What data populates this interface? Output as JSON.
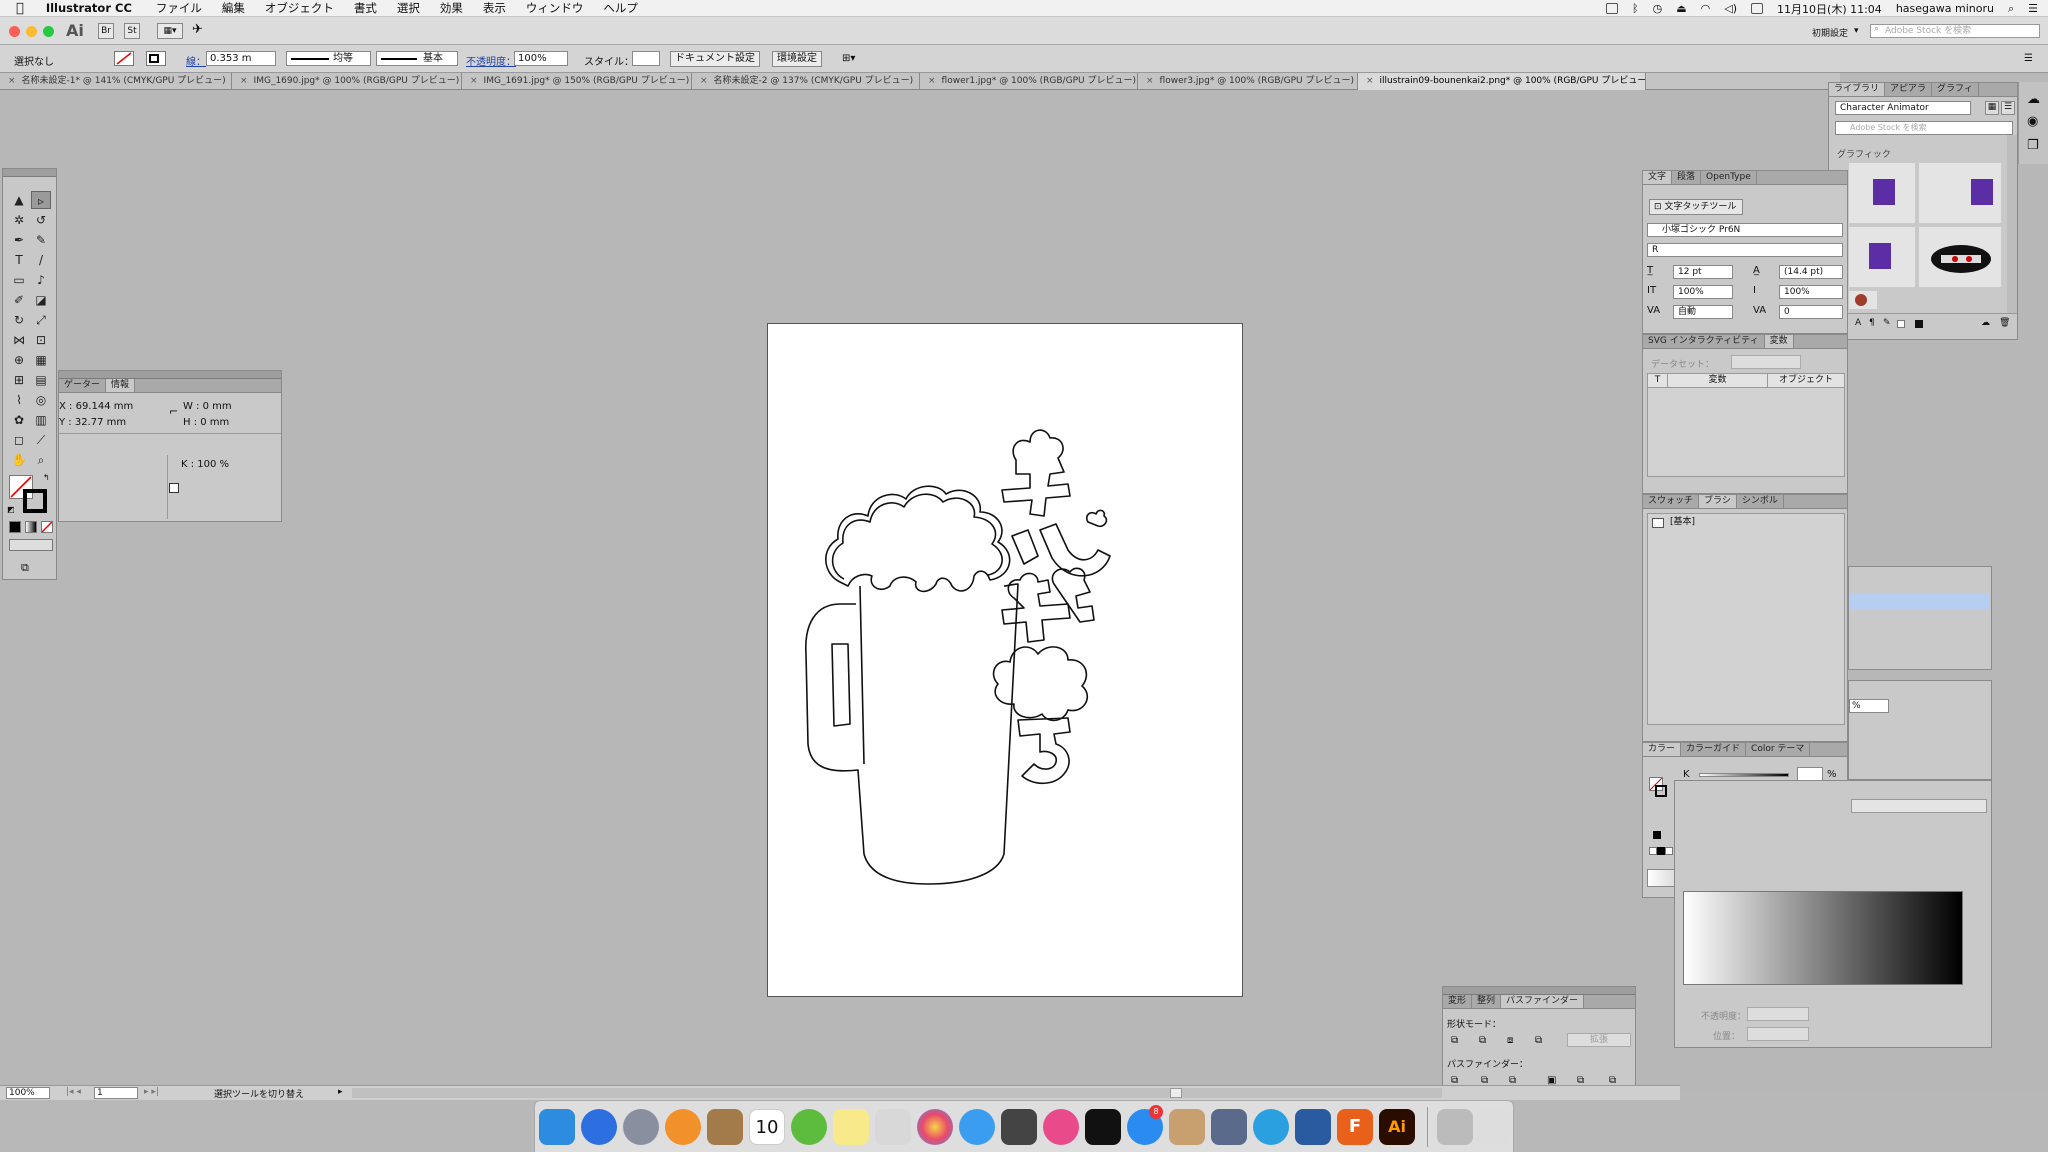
{
  "menubar": {
    "app_name": "Illustrator CC",
    "items": [
      "ファイル",
      "編集",
      "オブジェクト",
      "書式",
      "選択",
      "効果",
      "表示",
      "ウィンドウ",
      "ヘルプ"
    ],
    "datetime": "11月10日(木) 11:04",
    "user": "hasegawa minoru"
  },
  "appbar": {
    "logo": "Ai",
    "workspace": "初期設定",
    "search_placeholder": "Adobe Stock を検索"
  },
  "controlbar": {
    "selection": "選択なし",
    "stroke_label": "線：",
    "stroke_weight": "0.353 m",
    "profile": "均等",
    "brush": "基本",
    "opacity_label": "不透明度：",
    "opacity": "100%",
    "style_label": "スタイル：",
    "doc_setup": "ドキュメント設定",
    "preferences": "環境設定"
  },
  "tabs": [
    "名称未設定-1* @ 141% (CMYK/GPU プレビュー)",
    "IMG_1690.jpg* @ 100% (RGB/GPU プレビュー)",
    "IMG_1691.jpg* @ 150% (RGB/GPU プレビュー)",
    "名称未設定-2 @ 137% (CMYK/GPU プレビュー)",
    "flower1.jpg* @ 100% (RGB/GPU プレビュー)",
    "flower3.jpg* @ 100% (RGB/GPU プレビュー)",
    "illustrain09-bounenkai2.png* @ 100% (RGB/GPU プレビュー)"
  ],
  "info_panel": {
    "tabs": [
      "ゲーター",
      "情報"
    ],
    "x": "X : 69.144 mm",
    "y": "Y : 32.77 mm",
    "w": "W : 0 mm",
    "h": "H : 0 mm",
    "k": "K : 100 %"
  },
  "libraries_panel": {
    "tabs": [
      "ライブラリ",
      "アピアラ",
      "グラフィ"
    ],
    "library": "Character Animator",
    "search_placeholder": "Adobe Stock を検索",
    "section": "グラフィック"
  },
  "character_panel": {
    "tabs": [
      "文字",
      "段落",
      "OpenType"
    ],
    "touch_tool": "文字タッチツール",
    "font": "小塚ゴシック Pr6N",
    "style": "R",
    "size": "12 pt",
    "leading": "(14.4 pt)",
    "vscale": "100%",
    "hscale": "100%",
    "kerning": "自動",
    "tracking": "0"
  },
  "svg_panel": {
    "tabs": [
      "SVG インタラクティビティ",
      "変数"
    ],
    "dataset_label": "データセット：",
    "col_t": "T",
    "col_var": "変数",
    "col_obj": "オブジェクト"
  },
  "swatch_panel": {
    "tabs": [
      "スウォッチ",
      "ブラシ",
      "シンボル"
    ],
    "item": "[基本]"
  },
  "color_panel": {
    "tabs": [
      "カラー",
      "カラーガイド",
      "Color テーマ"
    ],
    "channel": "K",
    "unit": "%"
  },
  "pathfinder_panel": {
    "tabs": [
      "変形",
      "整列",
      "パスファインダー"
    ],
    "shape_modes": "形状モード：",
    "expand": "拡張",
    "pathfinders": "パスファインダー："
  },
  "transparency_panel": {
    "opacity_label": "不透明度：",
    "position_label": "位置："
  },
  "statusbar": {
    "zoom": "100%",
    "page": "1",
    "hint": "選択ツールを切り替え"
  },
  "dock": {
    "calendar_day": "10",
    "badge_count": "8"
  },
  "colors": {
    "ui_gray": "#c9c9c9",
    "canvas": "#b7b7b7",
    "artboard": "#ffffff",
    "swatch_purple": "#5b2ea6",
    "ai_orange": "#ff9a00"
  }
}
